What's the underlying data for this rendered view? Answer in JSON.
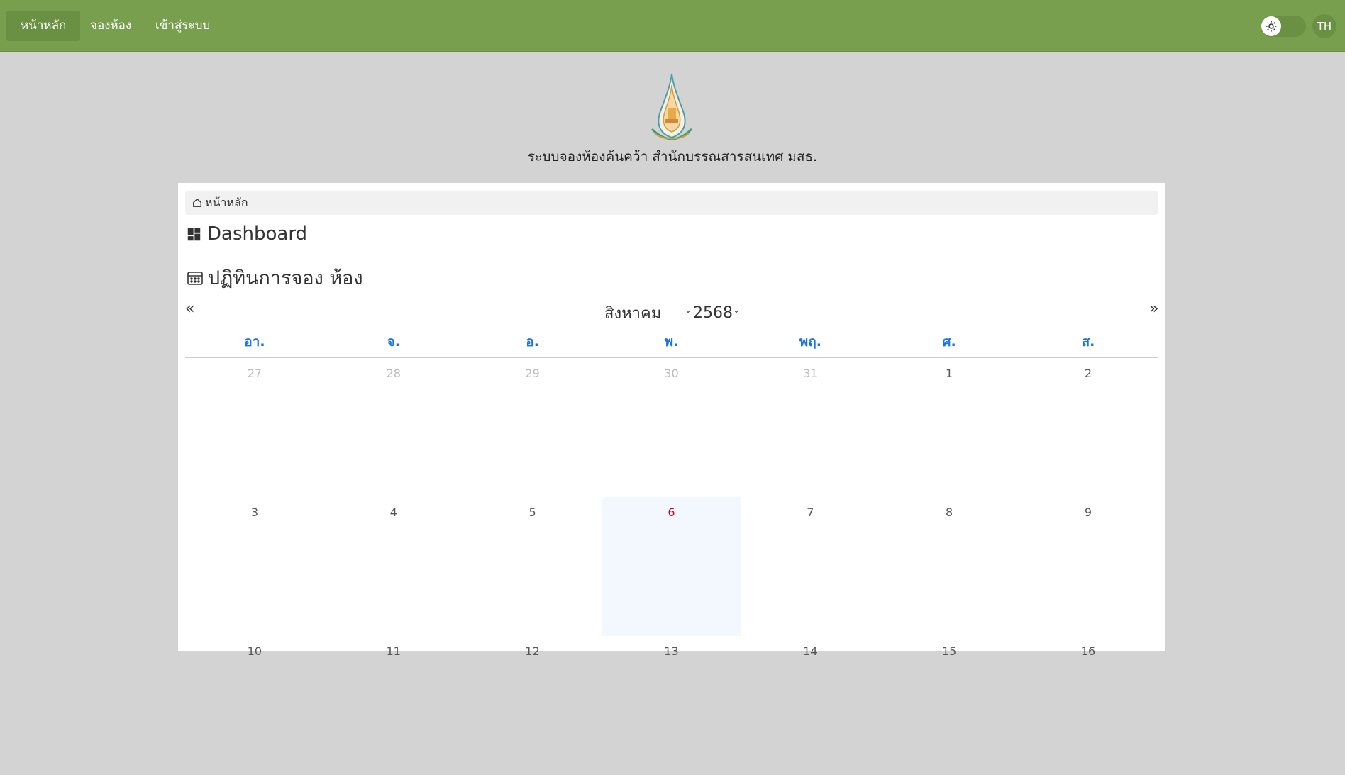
{
  "navbar": {
    "items": [
      {
        "label": "หน้าหลัก",
        "active": true
      },
      {
        "label": "จองห้อง",
        "active": false
      },
      {
        "label": "เข้าสู่ระบบ",
        "active": false
      }
    ],
    "theme_icon": "sun-icon",
    "language": "TH",
    "colors": {
      "bar": "#789f4e",
      "active": "#6a9043"
    }
  },
  "header": {
    "title": "ระบบจองห้องค้นคว้า สำนักบรรณสารสนเทศ มสธ."
  },
  "breadcrumb": {
    "home_label": "หน้าหลัก"
  },
  "dashboard": {
    "title": "Dashboard"
  },
  "calendar": {
    "title": "ปฏิทินการจอง ห้อง",
    "prev": "«",
    "next": "»",
    "month": "สิงหาคม",
    "year": "2568",
    "weekdays": [
      "อา.",
      "จ.",
      "อ.",
      "พ.",
      "พฤ.",
      "ศ.",
      "ส."
    ],
    "weeks": [
      [
        {
          "day": "27",
          "muted": true
        },
        {
          "day": "28",
          "muted": true
        },
        {
          "day": "29",
          "muted": true
        },
        {
          "day": "30",
          "muted": true
        },
        {
          "day": "31",
          "muted": true
        },
        {
          "day": "1"
        },
        {
          "day": "2"
        }
      ],
      [
        {
          "day": "3"
        },
        {
          "day": "4"
        },
        {
          "day": "5"
        },
        {
          "day": "6",
          "today": true
        },
        {
          "day": "7"
        },
        {
          "day": "8"
        },
        {
          "day": "9"
        }
      ],
      [
        {
          "day": "10"
        },
        {
          "day": "11"
        },
        {
          "day": "12"
        },
        {
          "day": "13"
        },
        {
          "day": "14"
        },
        {
          "day": "15"
        },
        {
          "day": "16"
        }
      ]
    ],
    "colors": {
      "weekday": "#1a73e8",
      "today_text": "#d0021b",
      "today_bg": "#f2f8fd"
    }
  }
}
